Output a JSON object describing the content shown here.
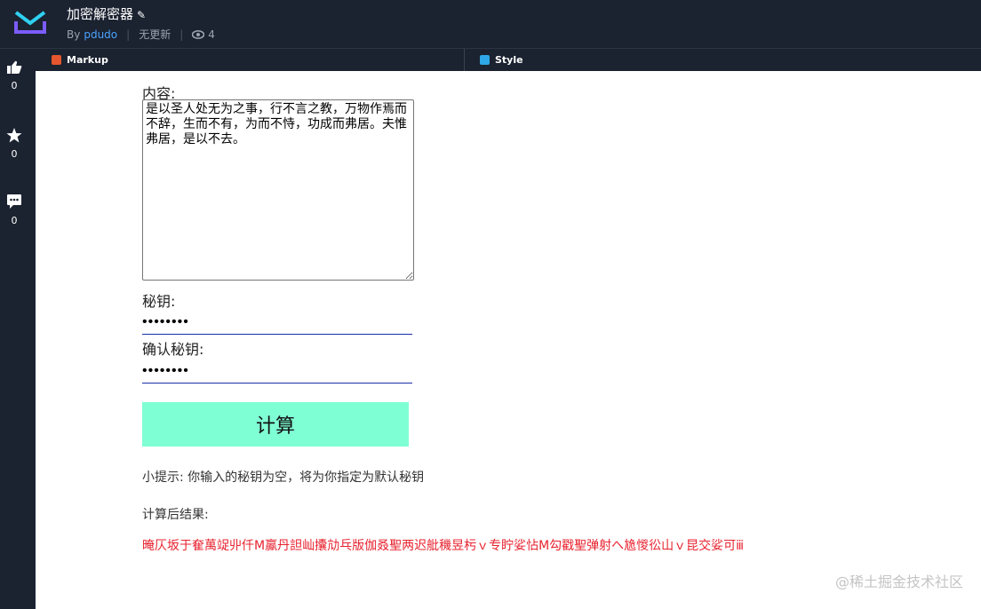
{
  "header": {
    "title": "加密解密器",
    "by_label": "By",
    "author": "pdudo",
    "update_status": "无更新",
    "view_count": "4"
  },
  "sidebar": {
    "like_count": "0",
    "star_count": "0",
    "comment_count": "0"
  },
  "tabs": {
    "markup": "Markup",
    "style": "Style"
  },
  "form": {
    "content_label": "内容:",
    "content_value": "是以圣人处无为之事，行不言之教，万物作焉而不辞，生而不有，为而不恃，功成而弗居。夫惟弗居，是以不去。",
    "key_label": "秘钥:",
    "key_value": "12345678",
    "confirm_label": "确认秘钥:",
    "confirm_value": "12345678",
    "calc_button": "计算"
  },
  "hint": "小提示: 你输入的秘钥为空，将为你指定为默认秘钥",
  "result_label": "计算后结果:",
  "result_value": "晻仄坂于奞萬䇍丱仟M鸁丹詚屾攮劥乓版伽叒聖两迟舭穖昱杇ｖ专眝娑怗M勾戳聖弹射へ尯惾彸山ｖ昆交娑可ⅲ",
  "watermark": "@稀土掘金技术社区",
  "colors": {
    "header_bg": "#1b2230",
    "accent_link": "#4aa3ff",
    "button_bg": "#7fffd4",
    "result_text": "#e8232f"
  }
}
